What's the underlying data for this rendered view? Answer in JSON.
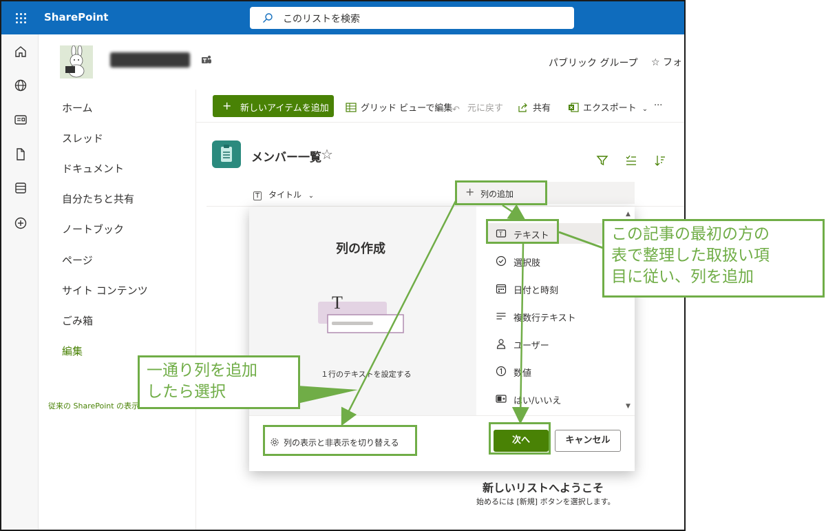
{
  "app": {
    "brand": "SharePoint"
  },
  "search": {
    "placeholder": "このリストを検索"
  },
  "site": {
    "group_type": "パブリック グループ",
    "follow_label": "フォ"
  },
  "leftnav": {
    "items": [
      "ホーム",
      "スレッド",
      "ドキュメント",
      "自分たちと共有",
      "ノートブック",
      "ページ",
      "サイト コンテンツ",
      "ごみ箱",
      "編集"
    ],
    "classic_link": "従来の SharePoint の表示"
  },
  "commandbar": {
    "new_item": "新しいアイテムを追加",
    "grid_edit": "グリッド ビューで編集",
    "undo": "元に戻す",
    "share": "共有",
    "export": "エクスポート",
    "more": "···"
  },
  "list": {
    "title": "メンバー一覧",
    "title_column": "タイトル",
    "add_column": "列の追加"
  },
  "create_column_panel": {
    "title": "列の作成",
    "description": "１行のテキストを設定する",
    "types": [
      {
        "label": "テキスト",
        "icon": "text-icon",
        "selected": true
      },
      {
        "label": "選択肢",
        "icon": "choice-icon"
      },
      {
        "label": "日付と時刻",
        "icon": "calendar-icon"
      },
      {
        "label": "複数行テキスト",
        "icon": "multiline-icon"
      },
      {
        "label": "ユーザー",
        "icon": "person-icon"
      },
      {
        "label": "数値",
        "icon": "number-icon"
      },
      {
        "label": "はい/いいえ",
        "icon": "yes-no-icon"
      }
    ],
    "toggle_link": "列の表示と非表示を切り替える",
    "next_button": "次へ",
    "cancel_button": "キャンセル"
  },
  "welcome": {
    "title": "新しいリストへようこそ",
    "subtitle": "始めるには [新規] ボタンを選択します。"
  },
  "annotations": {
    "right_callout": [
      "この記事の最初の方の",
      "表で整理した取扱い項",
      "目に従い、列を追加"
    ],
    "left_callout": [
      "一通り列を追加",
      "したら選択"
    ],
    "color": "#70ad47"
  },
  "colors": {
    "brand_blue": "#0f6cbd",
    "accent_green": "#498205"
  }
}
